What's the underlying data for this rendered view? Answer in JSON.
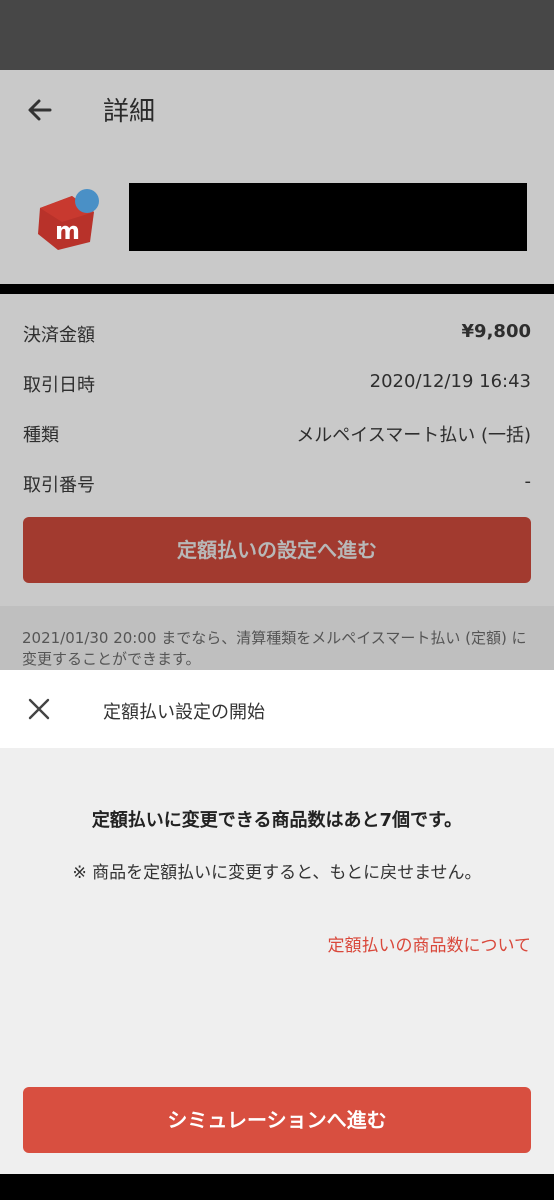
{
  "colors": {
    "accent": "#d84f40",
    "accent_dimmed": "#a23a2f",
    "link": "#d9483b",
    "sheet_background": "#efefef",
    "scrim_background": "#c9c9c9"
  },
  "appbar": {
    "title": "詳細",
    "back_icon": "arrow-left-icon"
  },
  "merchant": {
    "logo_icon": "mercari-logo"
  },
  "details": {
    "rows": [
      {
        "label": "決済金額",
        "value": "¥9,800"
      },
      {
        "label": "取引日時",
        "value": "2020/12/19 16:43"
      },
      {
        "label": "種類",
        "value": "メルペイスマート払い (一括)"
      },
      {
        "label": "取引番号",
        "value": "-"
      }
    ],
    "fixed_payment_button": "定額払いの設定へ進む",
    "notice": "2021/01/30 20:00 までなら、清算種類をメルペイスマート払い (定額) に変更することができます。"
  },
  "sheet": {
    "close_icon": "close-icon",
    "title": "定額払い設定の開始",
    "headline": "定額払いに変更できる商品数はあと7個です。",
    "warning": "※ 商品を定額払いに変更すると、もとに戻せません。",
    "info_link": "定額払いの商品数について",
    "simulation_button": "シミュレーションへ進む"
  }
}
